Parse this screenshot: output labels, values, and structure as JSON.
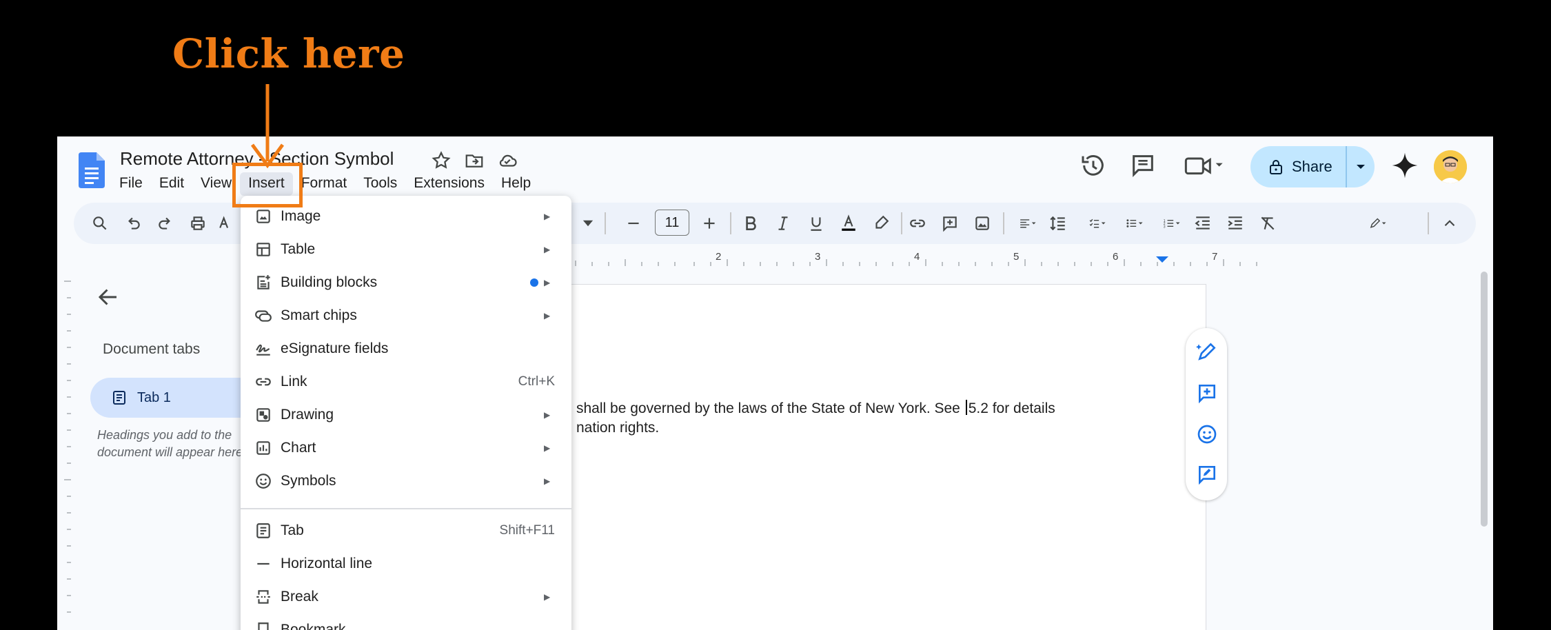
{
  "callout": {
    "text": "Click here",
    "color": "#f07c16"
  },
  "document": {
    "title": "Remote Attorney - Section Symbol"
  },
  "menubar": [
    "File",
    "Edit",
    "View",
    "Insert",
    "Format",
    "Tools",
    "Extensions",
    "Help"
  ],
  "share": {
    "label": "Share"
  },
  "toolbar": {
    "font_size": "11"
  },
  "ruler": {
    "numbers": [
      "2",
      "3",
      "4",
      "5",
      "6",
      "7"
    ]
  },
  "left_panel": {
    "heading": "Document tabs",
    "tab_label": "Tab 1",
    "hint": "Headings you add to the document will appear here."
  },
  "body": {
    "line1_before": "shall be governed by the laws of the State of New York. See ",
    "line1_after": "5.2 for details",
    "line2": "nation rights."
  },
  "insert_menu": {
    "items": [
      {
        "label": "Image",
        "icon": "image-icon",
        "submenu": true
      },
      {
        "label": "Table",
        "icon": "table-icon",
        "submenu": true
      },
      {
        "label": "Building blocks",
        "icon": "building-blocks-icon",
        "submenu": true,
        "new_dot": true
      },
      {
        "label": "Smart chips",
        "icon": "smart-chips-icon",
        "submenu": true
      },
      {
        "label": "eSignature fields",
        "icon": "esignature-icon",
        "submenu": false
      },
      {
        "label": "Link",
        "icon": "link-icon",
        "submenu": false,
        "shortcut": "Ctrl+K"
      },
      {
        "label": "Drawing",
        "icon": "drawing-icon",
        "submenu": true
      },
      {
        "label": "Chart",
        "icon": "chart-icon",
        "submenu": true
      },
      {
        "label": "Symbols",
        "icon": "symbols-icon",
        "submenu": true
      },
      {
        "label": "Tab",
        "icon": "tab-icon",
        "submenu": false,
        "shortcut": "Shift+F11"
      },
      {
        "label": "Horizontal line",
        "icon": "horizontal-line-icon",
        "submenu": false
      },
      {
        "label": "Break",
        "icon": "break-icon",
        "submenu": true
      },
      {
        "label": "Bookmark",
        "icon": "bookmark-icon",
        "submenu": false
      }
    ]
  },
  "colors": {
    "accent_blue": "#1a73e8",
    "share_bg": "#c2e7ff",
    "tab_active_bg": "#d3e3fd",
    "callout_orange": "#f07c16"
  }
}
